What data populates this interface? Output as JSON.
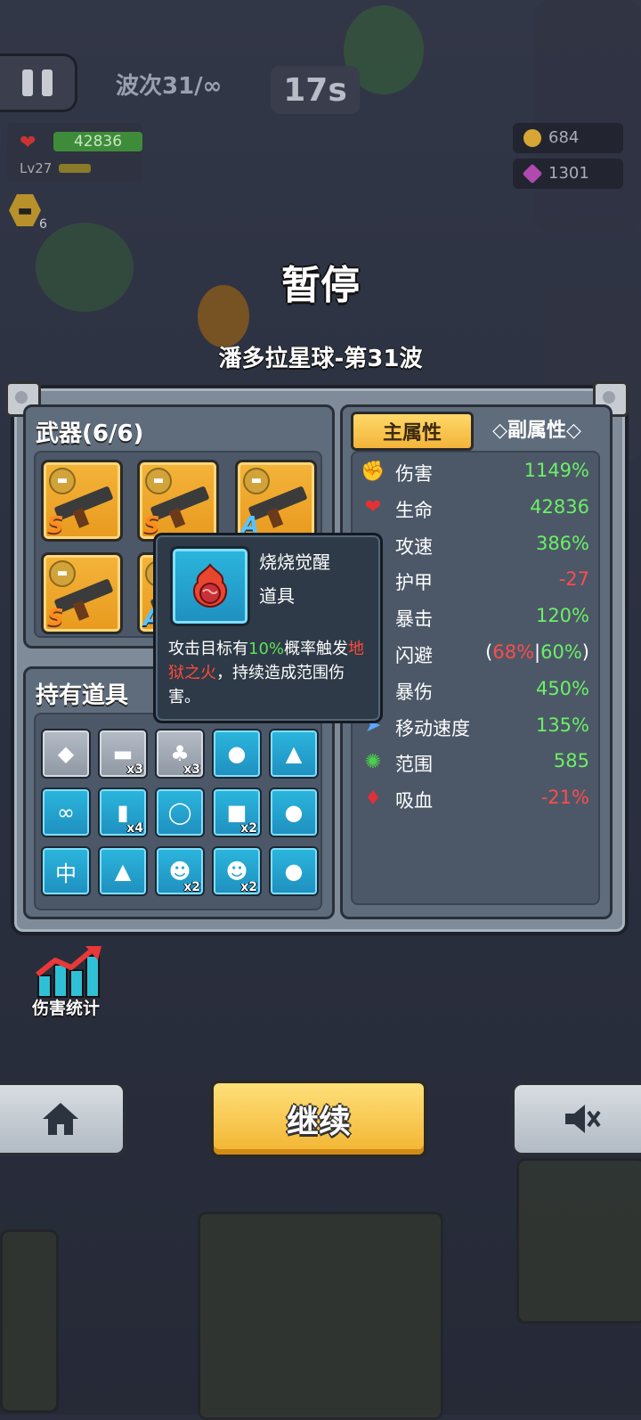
{
  "hud": {
    "wave": "波次31/∞",
    "timer": "17s",
    "hp": "42836",
    "level": "Lv27",
    "weapon_count": "6",
    "gold": "684",
    "gems": "1301"
  },
  "title": "暂停",
  "subtitle": "潘多拉星球-第31波",
  "weapons_panel": {
    "title": "武器(6/6)",
    "weapons": [
      {
        "rank": "S"
      },
      {
        "rank": "S"
      },
      {
        "rank": "A"
      },
      {
        "rank": "S"
      },
      {
        "rank": "A"
      }
    ]
  },
  "items_panel": {
    "title": "持有道具",
    "items": [
      {
        "icon": "green-gem-icon",
        "glyph": "◆",
        "count": ""
      },
      {
        "icon": "tickets-icon",
        "glyph": "▬",
        "count": "x3"
      },
      {
        "icon": "tree-icon",
        "glyph": "♣",
        "count": "x3"
      },
      {
        "icon": "fire-fruit-icon",
        "glyph": "●",
        "count": ""
      },
      {
        "icon": "shark-fin-icon",
        "glyph": "▲",
        "count": ""
      },
      {
        "icon": "goggles-icon",
        "glyph": "∞",
        "count": ""
      },
      {
        "icon": "fire-card-icon",
        "glyph": "▮",
        "count": "x4"
      },
      {
        "icon": "ring-goggles-icon",
        "glyph": "◯",
        "count": ""
      },
      {
        "icon": "chest-icon",
        "glyph": "■",
        "count": "x2"
      },
      {
        "icon": "orange-fruit-icon",
        "glyph": "●",
        "count": ""
      },
      {
        "icon": "mahjong-cards-icon",
        "glyph": "中",
        "count": ""
      },
      {
        "icon": "bullet-icon",
        "glyph": "▲",
        "count": ""
      },
      {
        "icon": "demon-girl-icon",
        "glyph": "☻",
        "count": "x2"
      },
      {
        "icon": "raccoon-icon",
        "glyph": "☻",
        "count": "x2"
      },
      {
        "icon": "golden-pig-icon",
        "glyph": "●",
        "count": ""
      }
    ]
  },
  "tooltip": {
    "name": "烧烧觉醒",
    "type": "道具",
    "desc_1": "攻击目标有",
    "desc_pct": "10%",
    "desc_2": "概率触发",
    "desc_effect": "地狱之火",
    "desc_3": "，持续造成范围伤害。"
  },
  "stats": {
    "tab_main": "主属性",
    "tab_sub": "◇副属性◇",
    "rows": [
      {
        "icon": "fist-icon",
        "glyph": "✊",
        "color": "#e0483a",
        "name": "伤害",
        "value": "1149%",
        "tone": "pos"
      },
      {
        "icon": "heart-icon",
        "glyph": "❤",
        "color": "#e83030",
        "name": "生命",
        "value": "42836",
        "tone": "pos"
      },
      {
        "icon": "attack-speed-icon",
        "glyph": "⚔",
        "color": "#f0c03a",
        "name": "攻速",
        "value": "386%",
        "tone": "pos"
      },
      {
        "icon": "shield-icon",
        "glyph": "⛨",
        "color": "#5aa0ff",
        "name": "护甲",
        "value": "-27",
        "tone": "neg"
      },
      {
        "icon": "crit-icon",
        "glyph": "✹",
        "color": "#ff5a3a",
        "name": "暴击",
        "value": "120%",
        "tone": "pos"
      },
      {
        "icon": "dodge-icon",
        "glyph": "≋",
        "color": "#7ac8ff",
        "name": "闪避",
        "value_open": "(",
        "value_a": "68%",
        "value_sep": "|",
        "value_b": "60%",
        "value_close": ")",
        "tone": "mix"
      },
      {
        "icon": "crit-damage-icon",
        "glyph": "✦",
        "color": "#ff4a4a",
        "name": "暴伤",
        "value": "450%",
        "tone": "pos"
      },
      {
        "icon": "boot-icon",
        "glyph": "➤",
        "color": "#5aa8ff",
        "name": "移动速度",
        "value": "135%",
        "tone": "pos"
      },
      {
        "icon": "range-icon",
        "glyph": "✺",
        "color": "#4bd04b",
        "name": "范围",
        "value": "585",
        "tone": "pos"
      },
      {
        "icon": "blood-drop-icon",
        "glyph": "♦",
        "color": "#e0303a",
        "name": "吸血",
        "value": "-21%",
        "tone": "neg"
      }
    ]
  },
  "bottom": {
    "damage_stats_label": "伤害统计",
    "continue_label": "继续",
    "home_icon": "home-icon",
    "mute_icon": "mute-icon"
  }
}
